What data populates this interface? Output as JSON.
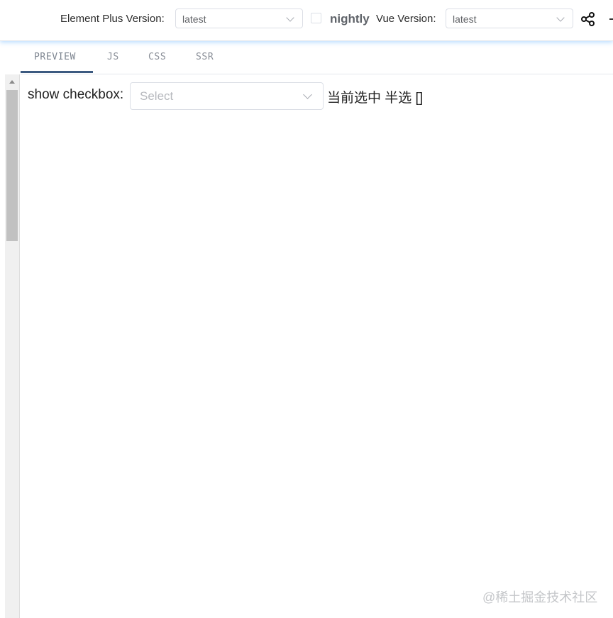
{
  "header": {
    "element_plus_label": "Element Plus Version:",
    "element_plus_version": "latest",
    "nightly_label": "nightly",
    "nightly_checked": false,
    "vue_label": "Vue Version:",
    "vue_version": "latest",
    "share_icon": "share-icon"
  },
  "tabs": [
    {
      "label": "PREVIEW",
      "active": true
    },
    {
      "label": "JS",
      "active": false
    },
    {
      "label": "CSS",
      "active": false
    },
    {
      "label": "SSR",
      "active": false
    }
  ],
  "preview": {
    "show_checkbox_label": "show checkbox:",
    "select_placeholder": "Select",
    "status_text": "当前选中 半选 []"
  },
  "watermark": "@稀土掘金技术社区",
  "colors": {
    "accent": "#409eff",
    "tab_active": "#3c5a80"
  }
}
